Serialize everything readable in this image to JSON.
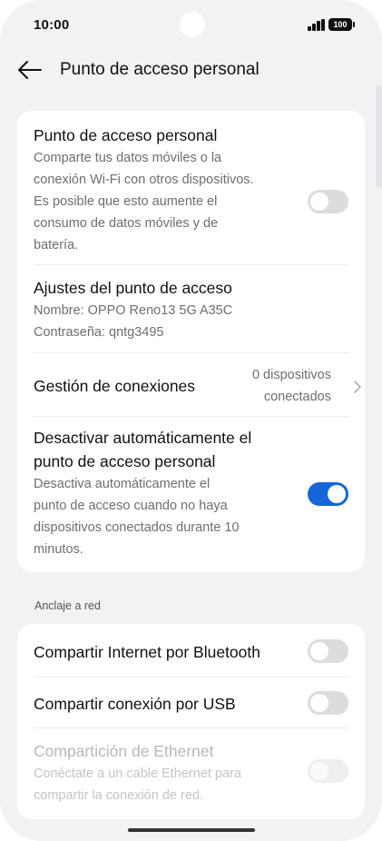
{
  "status": {
    "time": "10:00",
    "battery": "100"
  },
  "header": {
    "title": "Punto de acceso personal"
  },
  "hotspot": {
    "title": "Punto de acceso personal",
    "lines": [
      "Comparte tus datos móviles o la",
      "conexión Wi-Fi con otros dispositivos.",
      "Es posible que esto aumente el",
      "consumo de datos móviles y de",
      "batería."
    ],
    "enabled": false
  },
  "settings": {
    "title": "Ajustes del punto de acceso",
    "name_line": "Nombre: OPPO Reno13 5G A35C",
    "password_line": "Contraseña: qntg3495"
  },
  "connections": {
    "title": "Gestión de conexiones",
    "value_lines": [
      "0 dispositivos",
      "conectados"
    ]
  },
  "auto_off": {
    "title_lines": [
      "Desactivar automáticamente el",
      "punto de acceso personal"
    ],
    "lines": [
      "Desactiva automáticamente el",
      "punto de acceso cuando no haya",
      "dispositivos conectados durante 10",
      "minutos."
    ],
    "enabled": true
  },
  "tethering": {
    "section_label": "Anclaje a red",
    "bluetooth": {
      "title": "Compartir Internet por Bluetooth",
      "enabled": false
    },
    "usb": {
      "title": "Compartir conexión por USB",
      "enabled": false
    },
    "ethernet": {
      "title": "Compartición de Ethernet",
      "lines": [
        "Conéctate a un cable Ethernet para",
        "compartir la conexión de red."
      ],
      "enabled": false,
      "disabled": true
    }
  },
  "colors": {
    "accent": "#1565d8",
    "toggle_off": "#dcdcdc",
    "background": "#f1f2f4"
  }
}
